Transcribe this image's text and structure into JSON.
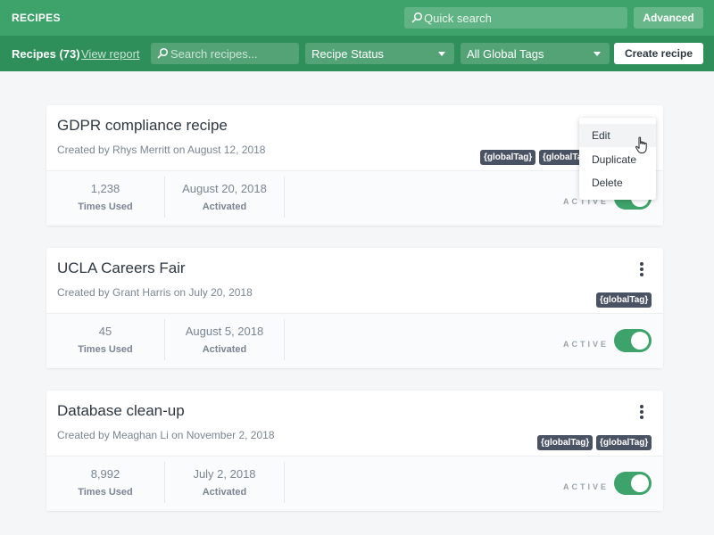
{
  "topbar": {
    "title": "RECIPES",
    "quick_search_placeholder": "Quick search",
    "advanced_label": "Advanced"
  },
  "subbar": {
    "recipes_count": "Recipes (73)",
    "view_report": "View report",
    "search_placeholder": "Search recipes...",
    "status_filter": "Recipe Status",
    "tags_filter": "All Global Tags",
    "create_label": "Create recipe"
  },
  "recipes": [
    {
      "title": "GDPR compliance recipe",
      "meta": "Created by Rhys Merritt on August 12, 2018",
      "tags": [
        "{globalTag}",
        "{globalTag}"
      ],
      "times_used": "1,238",
      "times_used_label": "Times Used",
      "activated": "August 20, 2018",
      "activated_label": "Activated",
      "status": "ACTIVE",
      "enabled": true
    },
    {
      "title": "UCLA Careers Fair",
      "meta": "Created by Grant Harris on July 20, 2018",
      "tags": [
        "{globalTag}"
      ],
      "times_used": "45",
      "times_used_label": "Times Used",
      "activated": "August 5, 2018",
      "activated_label": "Activated",
      "status": "ACTIVE",
      "enabled": true
    },
    {
      "title": "Database clean-up",
      "meta": "Created by Meaghan Li on November 2, 2018",
      "tags": [
        "{globalTag}",
        "{globalTag}"
      ],
      "times_used": "8,992",
      "times_used_label": "Times Used",
      "activated": "July 2, 2018",
      "activated_label": "Activated",
      "status": "ACTIVE",
      "enabled": true
    }
  ],
  "context_menu": {
    "items": [
      "Edit",
      "Duplicate",
      "Delete"
    ]
  },
  "colors": {
    "brand_green": "#3ea36a",
    "subbar_green": "#2f8f5a",
    "tag_bg": "#4a5363"
  },
  "icons": {
    "search": "search-icon",
    "caret": "chevron-down-icon",
    "more": "kebab-menu-icon",
    "cursor": "hand-pointer-icon"
  }
}
